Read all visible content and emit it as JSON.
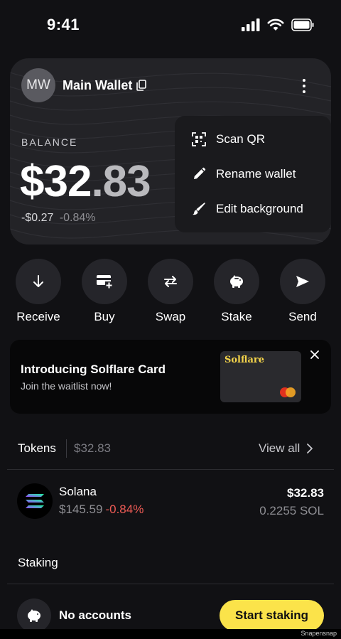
{
  "status_bar": {
    "time": "9:41"
  },
  "wallet": {
    "avatar_initials": "MW",
    "name": "Main Wallet",
    "balance_label": "BALANCE",
    "balance_whole": "$32",
    "balance_cents": ".83",
    "change_abs": "-$0.27",
    "change_pct": "-0.84%"
  },
  "menu": {
    "items": [
      {
        "label": "Scan QR",
        "icon": "qr-scan-icon"
      },
      {
        "label": "Rename wallet",
        "icon": "pencil-icon"
      },
      {
        "label": "Edit background",
        "icon": "brush-icon"
      }
    ]
  },
  "actions": [
    {
      "label": "Receive",
      "icon": "arrow-down-icon"
    },
    {
      "label": "Buy",
      "icon": "card-plus-icon"
    },
    {
      "label": "Swap",
      "icon": "swap-arrows-icon"
    },
    {
      "label": "Stake",
      "icon": "piggy-bank-icon"
    },
    {
      "label": "Send",
      "icon": "send-icon"
    }
  ],
  "promo": {
    "title": "Introducing Solflare Card",
    "subtitle": "Join the waitlist now!",
    "card_brand": "Solflare"
  },
  "tokens": {
    "title": "Tokens",
    "total": "$32.83",
    "view_all": "View all",
    "items": [
      {
        "name": "Solana",
        "price": "$145.59",
        "change": "-0.84%",
        "value": "$32.83",
        "amount": "0.2255 SOL"
      }
    ]
  },
  "staking": {
    "title": "Staking",
    "empty_label": "No accounts",
    "button_label": "Start staking"
  },
  "watermark": "Snapensnap",
  "colors": {
    "background": "#111114",
    "accent_yellow": "#fbe34a",
    "negative_red": "#ee5b55"
  }
}
